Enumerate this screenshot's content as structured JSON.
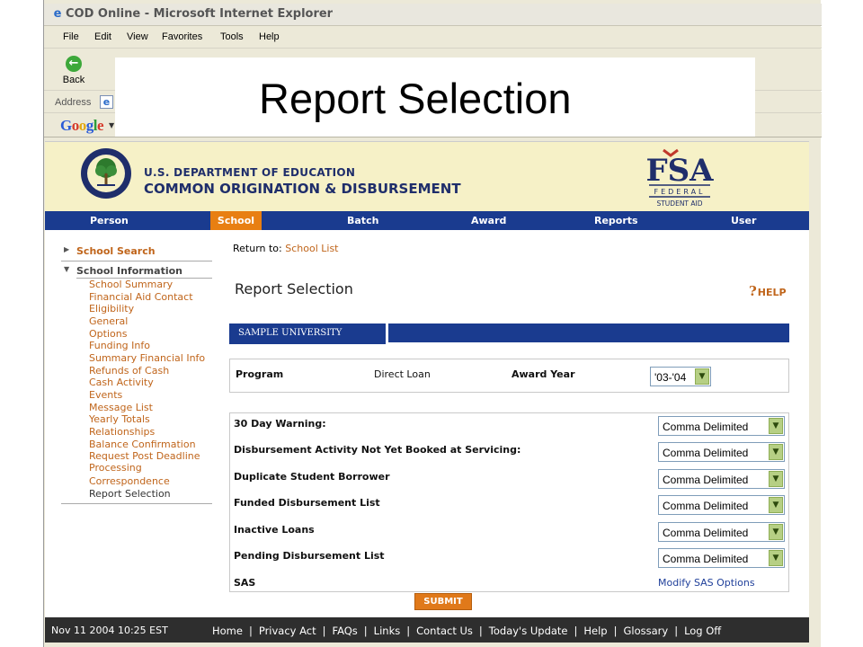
{
  "browser": {
    "title": "COD Online - Microsoft Internet Explorer",
    "menu": [
      "File",
      "Edit",
      "View",
      "Favorites",
      "Tools",
      "Help"
    ],
    "back_label": "Back",
    "address_label": "Address",
    "google_label": "Google"
  },
  "slide_title": "Report Selection",
  "header": {
    "dept": "U.S. DEPARTMENT OF EDUCATION",
    "system": "COMMON ORIGINATION & DISBURSEMENT",
    "logo_big": "FSA",
    "logo_sub1": "FEDERAL",
    "logo_sub2": "STUDENT AID"
  },
  "nav": {
    "items": [
      "Person",
      "School",
      "Batch",
      "Award",
      "Reports",
      "User"
    ],
    "active": "School",
    "active_color": "#e87f12",
    "bar_color": "#1a3b8f"
  },
  "sidebar": {
    "school_search": "School Search",
    "school_information": "School Information",
    "links": [
      "School Summary",
      "Financial Aid Contact",
      "Eligibility",
      "General",
      "Options",
      "Funding Info",
      "Summary Financial Info",
      "Refunds of Cash",
      "Cash Activity",
      "Events",
      "Message List",
      "Yearly Totals",
      "Relationships",
      "Balance Confirmation",
      "Request Post Deadline Processing",
      "Correspondence",
      "Report Selection"
    ]
  },
  "main": {
    "return_prefix": "Return to:",
    "return_link": "School List",
    "title": "Report Selection",
    "help": "HELP",
    "university": "SAMPLE UNIVERSITY",
    "program_label": "Program",
    "program_value": "Direct Loan",
    "award_year_label": "Award Year",
    "award_year_value": "'03-'04",
    "reports": [
      {
        "label": "30 Day Warning:",
        "format": "Comma Delimited"
      },
      {
        "label": "Disbursement Activity Not Yet Booked at Servicing:",
        "format": "Comma Delimited"
      },
      {
        "label": "Duplicate Student Borrower",
        "format": "Comma Delimited"
      },
      {
        "label": "Funded Disbursement List",
        "format": "Comma Delimited"
      },
      {
        "label": "Inactive Loans",
        "format": "Comma Delimited"
      },
      {
        "label": "Pending Disbursement List",
        "format": "Comma Delimited"
      }
    ],
    "sas_label": "SAS",
    "sas_link": "Modify SAS Options",
    "submit": "SUBMIT"
  },
  "footer": {
    "datetime": "Nov 11 2004 10:25 EST",
    "links": [
      "Home",
      "Privacy Act",
      "FAQs",
      "Links",
      "Contact Us",
      "Today's Update",
      "Help",
      "Glossary",
      "Log Off"
    ],
    "separator": "|"
  }
}
